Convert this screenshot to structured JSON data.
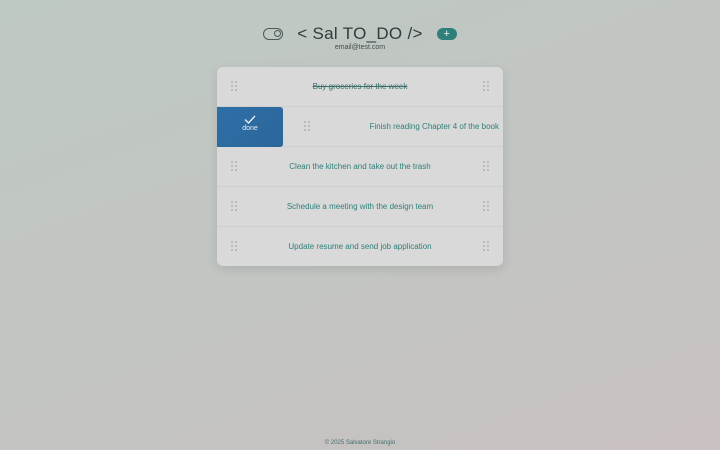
{
  "header": {
    "title": "< Sal TO_DO />",
    "add_label": "+",
    "email": "email@test.com"
  },
  "tasks": [
    {
      "label": "Buy groceries for the week",
      "completed": true
    },
    {
      "label": "Finish reading Chapter 4 of the book",
      "completed": false
    },
    {
      "label": "Clean the kitchen and take out the trash",
      "completed": false
    },
    {
      "label": "Schedule a meeting with the design team",
      "completed": false
    },
    {
      "label": "Update resume and send job application",
      "completed": false
    }
  ],
  "swipe_action": {
    "label": "done"
  },
  "footer": {
    "text": "© 2025 Salvatore Strangio"
  },
  "colors": {
    "accent": "#2f7f7a",
    "swipe": "#2f6fa8"
  }
}
